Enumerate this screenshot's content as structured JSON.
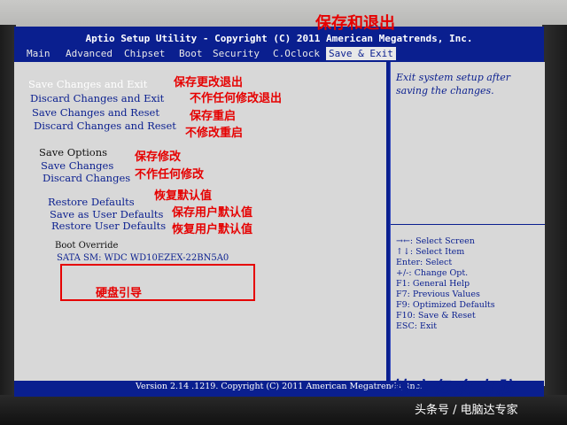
{
  "bios": {
    "title": "Aptio Setup Utility - Copyright (C) 2011 American Megatrends, Inc.",
    "tabs": [
      {
        "label": "Main"
      },
      {
        "label": "Advanced"
      },
      {
        "label": "Chipset"
      },
      {
        "label": "Boot"
      },
      {
        "label": "Security"
      },
      {
        "label": "C.Oclock"
      },
      {
        "label": "Save & Exit"
      }
    ],
    "active_tab": "Save & Exit",
    "options": {
      "save_changes_exit": "Save Changes and Exit",
      "discard_changes_exit": "Discard Changes and Exit",
      "save_changes_reset": "Save Changes and Reset",
      "discard_changes_reset": "Discard Changes and Reset",
      "save_options_header": "Save Options",
      "save_changes": "Save Changes",
      "discard_changes": "Discard Changes",
      "restore_defaults": "Restore Defaults",
      "save_user_defaults": "Save as User Defaults",
      "restore_user_defaults": "Restore User Defaults",
      "boot_override_header": "Boot Override",
      "boot_device": "SATA  SM: WDC WD10EZEX-22BN5A0"
    },
    "help_text": "Exit system setup after saving the changes.",
    "key_hints": [
      "→←: Select Screen",
      "↑↓: Select Item",
      "Enter: Select",
      "+/-: Change Opt.",
      "F1: General Help",
      "F7: Previous Values",
      "F9: Optimized Defaults",
      "F10: Save & Reset",
      "ESC: Exit"
    ],
    "footer": "Version 2.14 .1219. Copyright (C) 2011 American Megatrends, Inc."
  },
  "annotations": {
    "heading": "保存和退出",
    "save_changes_exit": "保存更改退出",
    "discard_changes_exit": "不作任何修改退出",
    "save_changes_reset": "保存重启",
    "discard_changes_reset": "不修改重启",
    "save_changes": "保存修改",
    "discard_changes": "不作任何修改",
    "restore_defaults": "恢复默认值",
    "save_user_defaults": "保存用户默认值",
    "restore_user_defaults": "恢复用户默认值",
    "boot_override": "硬盘引导"
  },
  "watermark": "韩店亿众电脑",
  "source": "头条号 / 电脑达专家",
  "colors": {
    "bios_blue": "#0a1f8f",
    "panel_gray": "#d8d8d8",
    "annotation_red": "#e60000"
  }
}
